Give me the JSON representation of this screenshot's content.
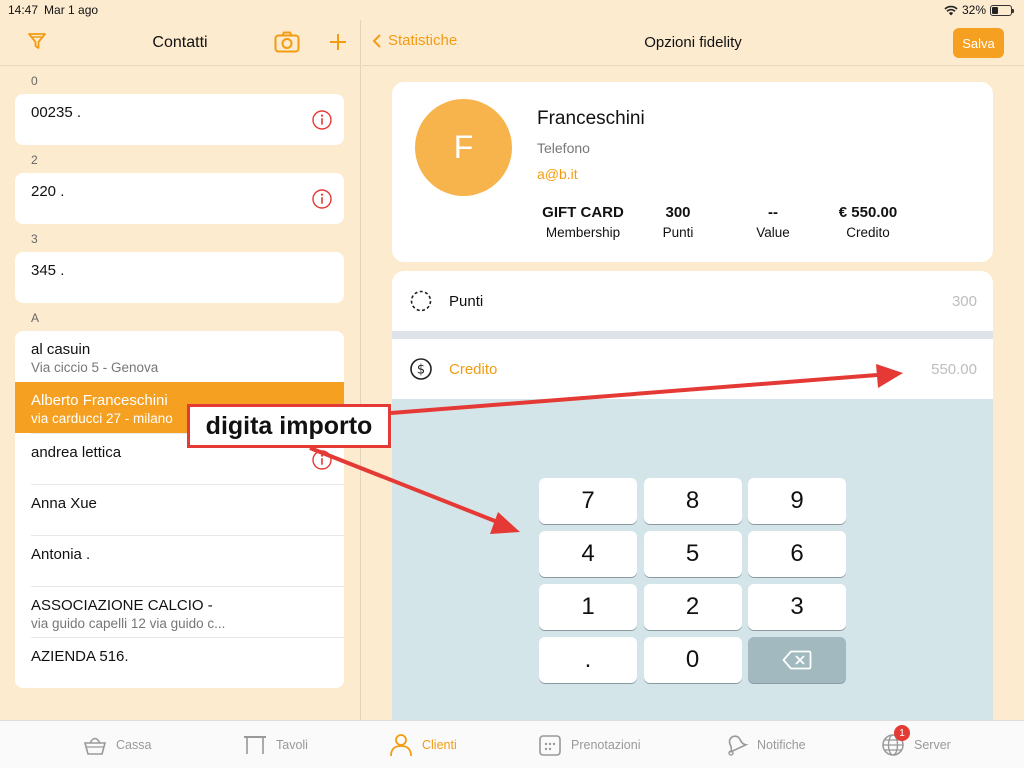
{
  "status": {
    "time": "14:47",
    "date": "Mar 1 ago",
    "battery": "32%",
    "battery_level": 0.32
  },
  "left": {
    "title": "Contatti",
    "sections": [
      {
        "label": "0",
        "rows": [
          {
            "name": "00235 .",
            "addr": "",
            "info": true
          }
        ]
      },
      {
        "label": "2",
        "rows": [
          {
            "name": "220 .",
            "addr": "",
            "info": true
          }
        ]
      },
      {
        "label": "3",
        "rows": [
          {
            "name": "345 .",
            "addr": "",
            "info": false
          }
        ]
      },
      {
        "label": "A",
        "rows": [
          {
            "name": "al casuin",
            "addr": "Via ciccio 5 - Genova",
            "info": false
          },
          {
            "name": "Alberto Franceschini",
            "addr": "via carducci  27 - milano",
            "info": false,
            "selected": true
          },
          {
            "name": "andrea lettica",
            "addr": "",
            "info": true
          },
          {
            "name": "Anna Xue",
            "addr": "",
            "info": false
          },
          {
            "name": "Antonia .",
            "addr": "",
            "info": false
          },
          {
            "name": "ASSOCIAZIONE CALCIO -",
            "addr": "via guido capelli 12 via guido c...",
            "info": false
          },
          {
            "name": "AZIENDA 516.",
            "addr": "",
            "info": false
          }
        ]
      }
    ]
  },
  "right": {
    "back_label": "Statistiche",
    "title": "Opzioni fidelity",
    "save_label": "Salva",
    "profile": {
      "initial": "F",
      "name": "Franceschini",
      "phone": "Telefono",
      "email": "a@b.it",
      "stats": [
        {
          "value": "GIFT CARD",
          "label": "Membership"
        },
        {
          "value": "300",
          "label": "Punti"
        },
        {
          "value": "--",
          "label": "Value"
        },
        {
          "value": "€ 550.00",
          "label": "Credito"
        }
      ]
    },
    "fields": {
      "punti": {
        "label": "Punti",
        "value": "300"
      },
      "credito": {
        "label": "Credito",
        "value": "550.00"
      }
    },
    "keypad": [
      "7",
      "8",
      "9",
      "4",
      "5",
      "6",
      "1",
      "2",
      "3",
      ".",
      "0",
      "⌫"
    ]
  },
  "annotation": {
    "text": "digita importo",
    "color": "#e53935"
  },
  "tabs": [
    {
      "label": "Cassa",
      "icon": "basket-icon"
    },
    {
      "label": "Tavoli",
      "icon": "table-icon"
    },
    {
      "label": "Clienti",
      "icon": "person-icon",
      "active": true
    },
    {
      "label": "Prenotazioni",
      "icon": "calendar-icon"
    },
    {
      "label": "Notifiche",
      "icon": "bell-icon"
    },
    {
      "label": "Server",
      "icon": "globe-icon",
      "badge": "1"
    }
  ],
  "colors": {
    "accent": "#f39c12",
    "background": "#fdebd0",
    "keypad": "#d4e5e9"
  }
}
